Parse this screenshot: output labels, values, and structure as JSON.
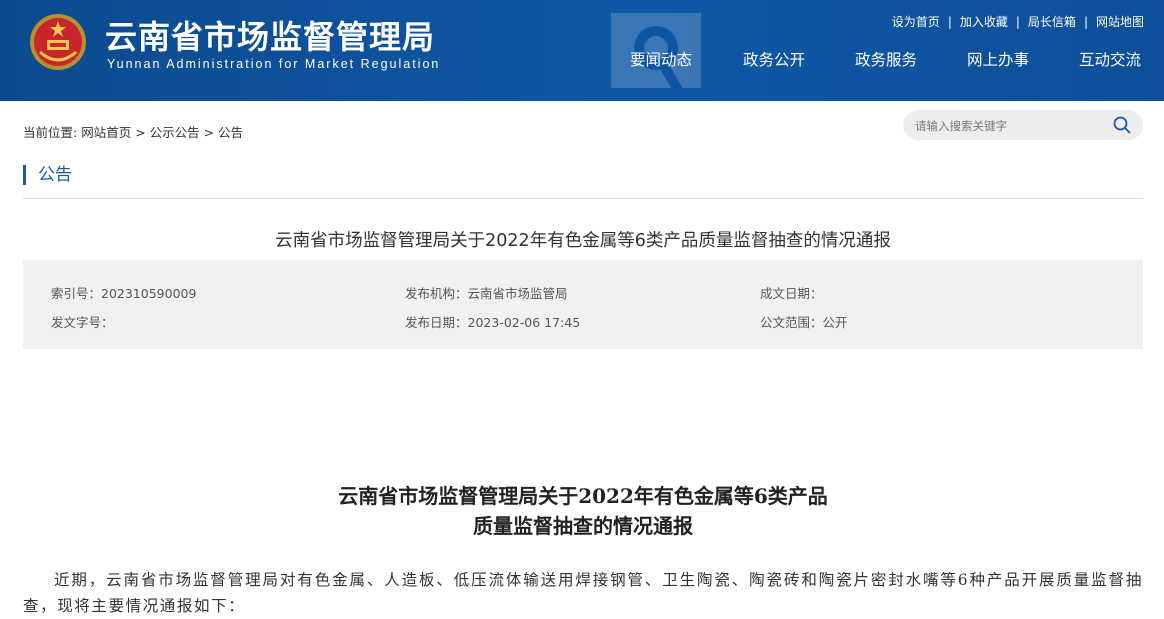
{
  "header": {
    "title": "云南省市场监督管理局",
    "subtitle": "Yunnan Administration for Market Regulation",
    "toplinks": [
      "设为首页",
      "加入收藏",
      "局长信箱",
      "网站地图"
    ],
    "nav": [
      "要闻动态",
      "政务公开",
      "政务服务",
      "网上办事",
      "互动交流"
    ]
  },
  "breadcrumb": {
    "prefix": "当前位置:",
    "items": [
      "网站首页",
      "公示公告",
      "公告"
    ],
    "separator": ">"
  },
  "search": {
    "placeholder": "请输入搜索关键字"
  },
  "section": {
    "title": "公告"
  },
  "article": {
    "title": "云南省市场监督管理局关于2022年有色金属等6类产品质量监督抽查的情况通报",
    "meta": {
      "index_no": "索引号：202310590009",
      "publisher": "发布机构：云南省市场监管局",
      "created": "成文日期：",
      "doc_no": "发文字号：",
      "published": "发布日期：2023-02-06 17:45",
      "scope": "公文范围：公开"
    },
    "body_title_line1": "云南省市场监督管理局关于2022年有色金属等6类产品",
    "body_title_line2": "质量监督抽查的情况通报",
    "paragraph1": "近期，云南省市场监督管理局对有色金属、人造板、低压流体输送用焊接钢管、卫生陶瓷、陶瓷砖和陶瓷片密封水嘴等6种产品开展质量监督抽查，现将主要情况通报如下："
  },
  "colors": {
    "header_bg": "#0f58a6",
    "accent": "#1a5aa5",
    "meta_bg": "#f1f1f1"
  }
}
